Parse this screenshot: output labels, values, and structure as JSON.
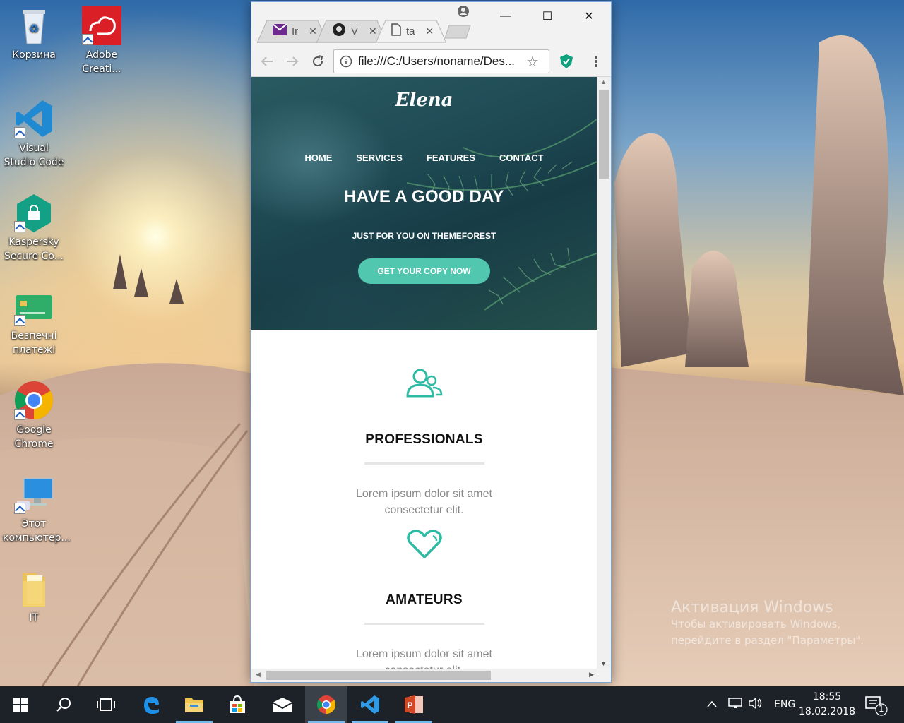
{
  "desktop": {
    "icons": [
      {
        "label": "Корзина"
      },
      {
        "label": "Adobe Creati..."
      },
      {
        "label": "Visual Studio Code"
      },
      {
        "label": "Kaspersky Secure Co..."
      },
      {
        "label": "Безпечні платежі"
      },
      {
        "label": "Google Chrome"
      },
      {
        "label": "Этот компьютер..."
      },
      {
        "label": "IT"
      }
    ],
    "activation": {
      "title": "Активация Windows",
      "line1": "Чтобы активировать Windows,",
      "line2": "перейдите в раздел \"Параметры\"."
    }
  },
  "browser": {
    "tabs": [
      {
        "title": "Ir",
        "icon": "mail-icon"
      },
      {
        "title": "V",
        "icon": "github-icon"
      },
      {
        "title": "ta",
        "icon": "page-icon"
      }
    ],
    "url": "file:///C:/Users/noname/Des..."
  },
  "page": {
    "logo": "Elena",
    "menu": [
      "HOME",
      "SERVICES",
      "FEATURES",
      "CONTACT"
    ],
    "headline": "HAVE A GOOD DAY",
    "subheadline": "JUST FOR YOU ON THEMEFOREST",
    "cta": "GET YOUR COPY NOW",
    "accent": "#52c7b0",
    "features": [
      {
        "title": "PROFESSIONALS",
        "text1": "Lorem ipsum dolor sit amet",
        "text2": "consectetur elit.",
        "icon": "users-icon"
      },
      {
        "title": "AMATEURS",
        "text1": "Lorem ipsum dolor sit amet",
        "text2": "consectetur elit.",
        "icon": "heart-icon"
      }
    ]
  },
  "taskbar": {
    "language": "ENG",
    "time": "18:55",
    "date": "18.02.2018",
    "notifications": "1"
  }
}
